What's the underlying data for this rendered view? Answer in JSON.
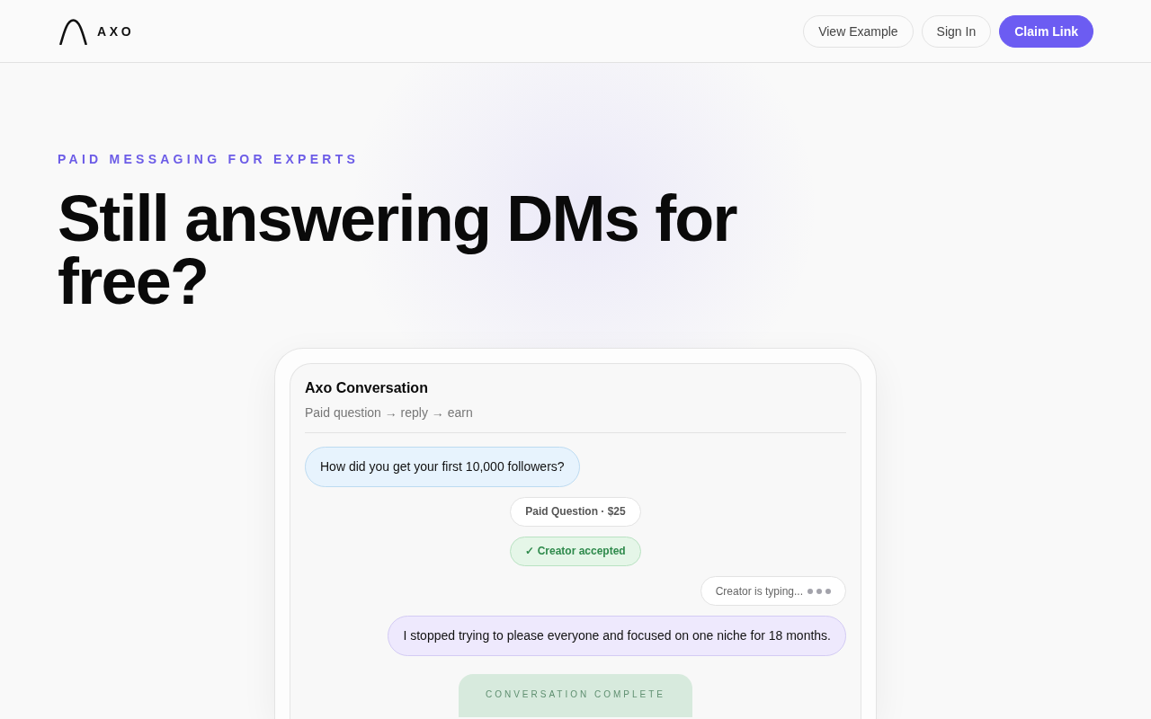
{
  "header": {
    "logo_text": "AXO",
    "buttons": [
      {
        "label": "View Example",
        "kind": "outline"
      },
      {
        "label": "Sign In",
        "kind": "outline"
      },
      {
        "label": "Claim Link",
        "kind": "primary"
      }
    ]
  },
  "hero": {
    "eyebrow": "PAID MESSAGING FOR EXPERTS",
    "headline": "Still answering DMs for free?"
  },
  "conversation": {
    "title": "Axo Conversation",
    "subtitle": "Paid question → reply → earn",
    "messages": [
      {
        "kind": "question",
        "text": "How did you get your first 10,000 followers?"
      },
      {
        "kind": "price",
        "text": "Paid Question · $25"
      },
      {
        "kind": "status",
        "text": "✓ Creator accepted"
      },
      {
        "kind": "typing",
        "text": "Creator is typing..."
      },
      {
        "kind": "answer",
        "text": "I stopped trying to please everyone and focused on one niche for 18 months."
      }
    ],
    "summary": {
      "label": "CONVERSATION COMPLETE"
    }
  }
}
